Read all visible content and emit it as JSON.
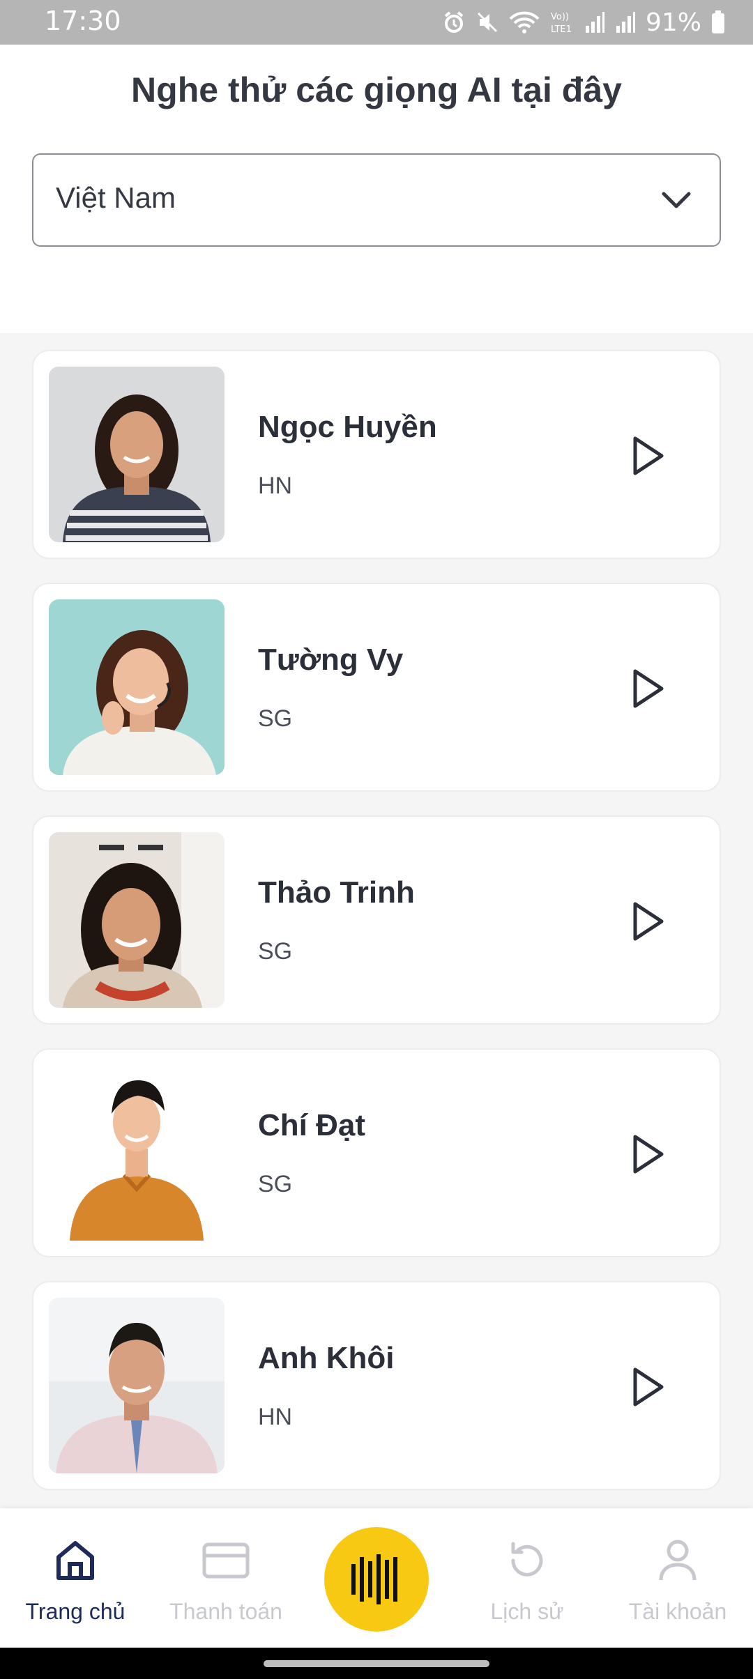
{
  "status_bar": {
    "time": "17:30",
    "battery": "91%",
    "icons": [
      "alarm-icon",
      "mute-icon",
      "wifi-icon",
      "volte-icon",
      "signal-icon",
      "signal-icon",
      "battery-icon"
    ]
  },
  "header": {
    "title": "Nghe thử các giọng AI tại đây"
  },
  "country_select": {
    "value": "Việt Nam",
    "icon": "chevron-down-icon"
  },
  "voices": [
    {
      "name": "Ngọc Huyền",
      "region": "HN",
      "play_icon": "play-icon"
    },
    {
      "name": "Tường Vy",
      "region": "SG",
      "play_icon": "play-icon"
    },
    {
      "name": "Thảo Trinh",
      "region": "SG",
      "play_icon": "play-icon"
    },
    {
      "name": "Chí Đạt",
      "region": "SG",
      "play_icon": "play-icon"
    },
    {
      "name": "Anh Khôi",
      "region": "HN",
      "play_icon": "play-icon"
    }
  ],
  "bottom_nav": {
    "items": [
      {
        "label": "Trang chủ",
        "icon": "home-icon",
        "active": true
      },
      {
        "label": "Thanh toán",
        "icon": "card-icon",
        "active": false
      },
      {
        "label": "",
        "icon": "voice-wave-icon",
        "active": false
      },
      {
        "label": "Lịch sử",
        "icon": "history-icon",
        "active": false
      },
      {
        "label": "Tài khoản",
        "icon": "user-icon",
        "active": false
      }
    ]
  },
  "colors": {
    "accent": "#f8c912",
    "active_nav": "#1d2a5a",
    "inactive_nav": "#c7c9ce",
    "list_background": "#f5f5f5"
  }
}
